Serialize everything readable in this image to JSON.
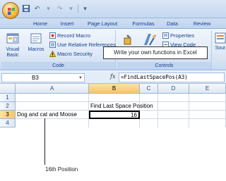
{
  "qat": {
    "icons": [
      "save-icon",
      "undo-icon",
      "redo-icon",
      "customize-icon"
    ]
  },
  "tabs": [
    "Home",
    "Insert",
    "Page Layout",
    "Formulas",
    "Data",
    "Review"
  ],
  "ribbon": {
    "code": {
      "label": "Code",
      "visual_basic": "Visual Basic",
      "macros": "Macros",
      "record_macro": "Record Macro",
      "use_relative": "Use Relative References",
      "macro_security": "Macro Security"
    },
    "controls": {
      "label": "Controls",
      "properties": "Properties",
      "view_code": "View Code",
      "source": "Sour"
    }
  },
  "callout": "Write your own functions in Excel",
  "formula_bar": {
    "name_box": "B3",
    "fx": "fx",
    "formula": "=FindLastSpacePos(A3)"
  },
  "sheet": {
    "columns": [
      "A",
      "B",
      "C",
      "D",
      "E"
    ],
    "rows": [
      "1",
      "2",
      "3",
      "4"
    ],
    "cells": {
      "B2": "Find Last Space Position",
      "A3": "Dog and cat and Moose",
      "B3": "16"
    }
  },
  "annotation": "16th Position",
  "colors": {
    "ribbon": "#dfe9f7",
    "selected_header": "#f7c56a",
    "grid_line": "#d0d7e5"
  }
}
